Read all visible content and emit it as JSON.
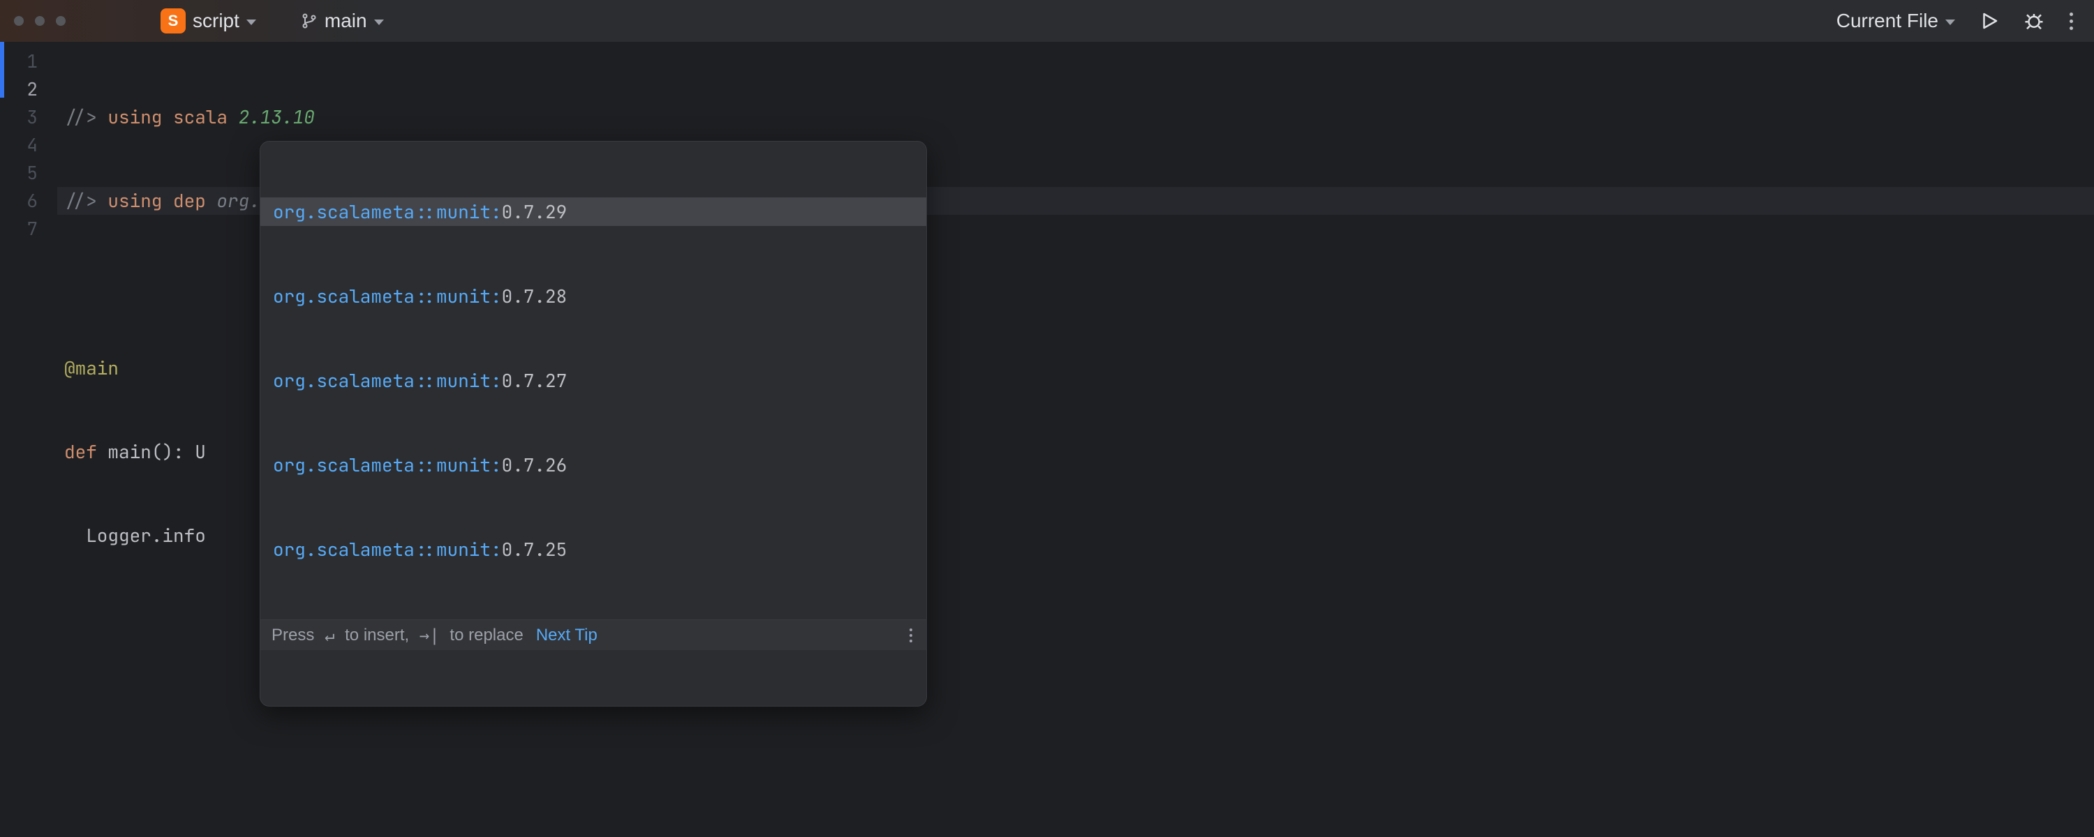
{
  "titlebar": {
    "file_badge_letter": "S",
    "file_name": "script",
    "branch_name": "main",
    "run_config": "Current File"
  },
  "gutter": {
    "lines": [
      "1",
      "2",
      "3",
      "4",
      "5",
      "6",
      "7"
    ],
    "active_index": 1
  },
  "code": {
    "l1_a": "//> ",
    "l1_b": "using scala ",
    "l1_c": "2.13.10",
    "l2_a": "//> ",
    "l2_b": "using dep ",
    "l2_c": "org.scalameta::munit:",
    "l4": "@main",
    "l5_a": "def",
    "l5_b": " main(): U",
    "l6": "  Logger.info"
  },
  "completion": {
    "prefix": "org.scalameta::munit:",
    "items": [
      {
        "version": "0.7.29",
        "selected": true
      },
      {
        "version": "0.7.28",
        "selected": false
      },
      {
        "version": "0.7.27",
        "selected": false
      },
      {
        "version": "0.7.26",
        "selected": false
      },
      {
        "version": "0.7.25",
        "selected": false
      }
    ],
    "footer_a": "Press ",
    "footer_enter": "↵",
    "footer_b": " to insert, ",
    "footer_tab": "→|",
    "footer_c": " to replace",
    "next_tip": "Next Tip"
  }
}
